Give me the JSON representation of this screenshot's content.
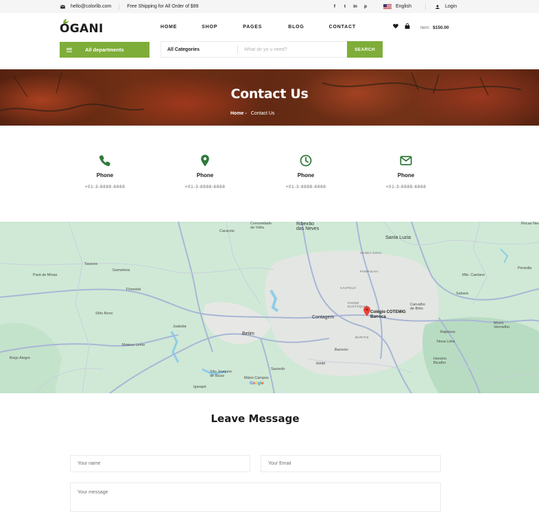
{
  "topbar": {
    "email": "hello@colorlib.com",
    "shipping": "Free Shipping for All Order of $99",
    "social": [
      "f",
      "t",
      "in",
      "p"
    ],
    "language": "English",
    "login": "Login"
  },
  "header": {
    "logo": "OGANI",
    "nav": [
      "HOME",
      "SHOP",
      "PAGES",
      "BLOG",
      "CONTACT"
    ],
    "item_label": "item:",
    "item_total": "$150.00",
    "accent": "#7fad39"
  },
  "search": {
    "departments": "All departments",
    "category": "All Categories",
    "placeholder": "What do yo u need?",
    "button": "SEARCH"
  },
  "banner": {
    "title": "Contact Us",
    "crumb_home": "Home",
    "crumb_sep": "-",
    "crumb_current": "Contact Us"
  },
  "contact_info": [
    {
      "icon": "phone-icon",
      "title": "Phone",
      "value": "+01-3-8888-6868"
    },
    {
      "icon": "map-pin-icon",
      "title": "Phone",
      "value": "+01-3-8888-6868"
    },
    {
      "icon": "clock-icon",
      "title": "Phone",
      "value": "+01-3-8888-6868"
    },
    {
      "icon": "mail-icon",
      "title": "Phone",
      "value": "+01-3-8888-6868"
    }
  ],
  "map": {
    "pin_label_1": "Colégio COTEMIG",
    "pin_label_2": "Barroca",
    "cities": [
      "Ribeirão das Neves",
      "Santa Luzia",
      "Contagem",
      "Betim",
      "Pará de Minas",
      "Florestal",
      "Sabará",
      "Brejo Alegre",
      "Igarapé",
      "Juatuba",
      "Mateus Leme",
      "Mário Campos",
      "Sarzedo",
      "Ibirité",
      "Barreiro",
      "Venda Nova",
      "Pampulha",
      "Castelo",
      "Padre Eustáquio",
      "Buritis"
    ],
    "attribution": "Google"
  },
  "message": {
    "title": "Leave Message",
    "name_placeholder": "Your name",
    "email_placeholder": "Your Email",
    "message_placeholder": "Your message"
  }
}
